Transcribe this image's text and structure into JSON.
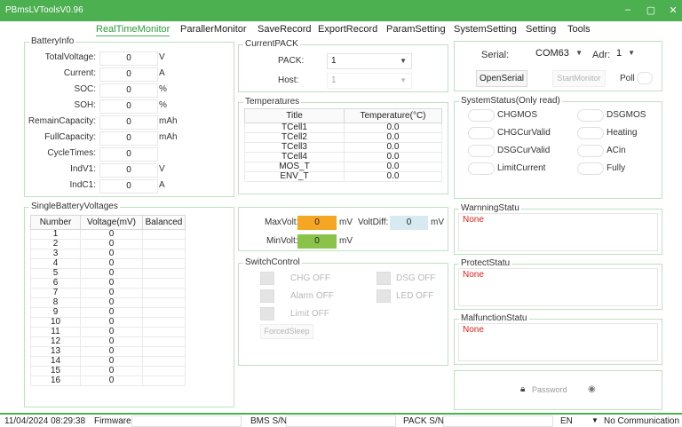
{
  "window": {
    "title": "PBmsLVToolsV0.96",
    "minimize": "–",
    "maximize": "▢",
    "close": "✕"
  },
  "menu": {
    "items": [
      {
        "label": "RealTimeMonitor"
      },
      {
        "label": "ParallerMonitor"
      },
      {
        "label": "SaveRecord"
      },
      {
        "label": "ExportRecord"
      },
      {
        "label": "ParamSetting"
      },
      {
        "label": "SystemSetting"
      },
      {
        "label": "Setting"
      },
      {
        "label": "Tools"
      }
    ]
  },
  "battery_info": {
    "title": "BatteryInfo",
    "rows": [
      {
        "label": "TotalVoltage:",
        "value": "0",
        "unit": "V"
      },
      {
        "label": "Current:",
        "value": "0",
        "unit": "A"
      },
      {
        "label": "SOC:",
        "value": "0",
        "unit": "%"
      },
      {
        "label": "SOH:",
        "value": "0",
        "unit": "%"
      },
      {
        "label": "RemainCapacity:",
        "value": "0",
        "unit": "mAh"
      },
      {
        "label": "FullCapacity:",
        "value": "0",
        "unit": "mAh"
      },
      {
        "label": "CycleTimes:",
        "value": "0",
        "unit": ""
      },
      {
        "label": "IndV1:",
        "value": "0",
        "unit": "V"
      },
      {
        "label": "IndC1:",
        "value": "0",
        "unit": "A"
      }
    ]
  },
  "current_pack": {
    "title": "CurrentPACK",
    "pack_label": "PACK:",
    "pack_value": "1",
    "host_label": "Host:",
    "host_value": "1"
  },
  "serial": {
    "serial_label": "Serial:",
    "serial_value": "COM63",
    "adr_label": "Adr:",
    "adr_value": "1",
    "open_button": "OpenSerial",
    "start_button": "StartMonitor",
    "poll_label": "Poll"
  },
  "temperatures": {
    "title": "Temperatures",
    "headers": [
      "Title",
      "Temperature(°C)"
    ],
    "rows": [
      [
        "TCell1",
        "0.0"
      ],
      [
        "TCell2",
        "0.0"
      ],
      [
        "TCell3",
        "0.0"
      ],
      [
        "TCell4",
        "0.0"
      ],
      [
        "MOS_T",
        "0.0"
      ],
      [
        "ENV_T",
        "0.0"
      ]
    ]
  },
  "system_status": {
    "title": "SystemStatus(Only read)",
    "items": [
      {
        "label": "CHGMOS"
      },
      {
        "label": "DSGMOS"
      },
      {
        "label": "CHGCurValid"
      },
      {
        "label": "Heating"
      },
      {
        "label": "DSGCurValid"
      },
      {
        "label": "ACin"
      },
      {
        "label": "LimitCurrent"
      },
      {
        "label": "Fully"
      }
    ]
  },
  "single_voltages": {
    "title": "SingleBatteryVoltages",
    "headers": [
      "Number",
      "Voltage(mV)",
      "Balanced"
    ],
    "rows": [
      [
        "1",
        "0",
        ""
      ],
      [
        "2",
        "0",
        ""
      ],
      [
        "3",
        "0",
        ""
      ],
      [
        "4",
        "0",
        ""
      ],
      [
        "5",
        "0",
        ""
      ],
      [
        "6",
        "0",
        ""
      ],
      [
        "7",
        "0",
        ""
      ],
      [
        "8",
        "0",
        ""
      ],
      [
        "9",
        "0",
        ""
      ],
      [
        "10",
        "0",
        ""
      ],
      [
        "11",
        "0",
        ""
      ],
      [
        "12",
        "0",
        ""
      ],
      [
        "13",
        "0",
        ""
      ],
      [
        "14",
        "0",
        ""
      ],
      [
        "15",
        "0",
        ""
      ],
      [
        "16",
        "0",
        ""
      ]
    ]
  },
  "volts": {
    "max_label": "MaxVolt:",
    "max_value": "0",
    "max_unit": "mV",
    "diff_label": "VoltDiff:",
    "diff_value": "0",
    "diff_unit": "mV",
    "min_label": "MinVolt:",
    "min_value": "0",
    "min_unit": "mV",
    "max_color": "#f5a623",
    "diff_color": "#d7e9f1",
    "min_color": "#8bc34a"
  },
  "switch_control": {
    "title": "SwitchControl",
    "chg": "CHG OFF",
    "dsg": "DSG OFF",
    "alarm": "Alarm OFF",
    "led": "LED OFF",
    "limit": "Limit OFF",
    "forced_sleep": "ForcedSleep"
  },
  "warning": {
    "title": "WarnningStatu",
    "value": "None"
  },
  "protect": {
    "title": "ProtectStatu",
    "value": "None"
  },
  "malfunction": {
    "title": "MalfunctionStatu",
    "value": "None"
  },
  "password": {
    "placeholder": "Password"
  },
  "statusbar": {
    "datetime": "11/04/2024 08:29:38",
    "firmware_label": "Firmware:",
    "bms_label": "BMS S/N:",
    "pack_label": "PACK S/N:",
    "lang": "EN",
    "comm": "No Communication"
  },
  "colors": {
    "accent": "#4caf50",
    "status_red": "#e0201b"
  }
}
